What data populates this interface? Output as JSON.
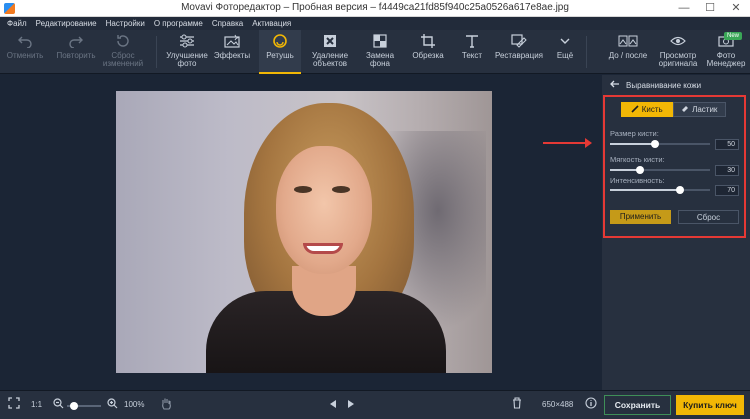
{
  "window": {
    "title": "Movavi Фоторедактор – Пробная версия – f4449ca21fd85f940c25a0526a617e8ae.jpg",
    "minimize": "—",
    "maximize": "☐",
    "close": "✕"
  },
  "menu": [
    "Файл",
    "Редактирование",
    "Настройки",
    "О программе",
    "Справка",
    "Активация"
  ],
  "toolbar": {
    "undo": "Отменить",
    "redo": "Повторить",
    "reset_changes": "Сброс\nизменений",
    "enhance": "Улучшение\nфото",
    "effects": "Эффекты",
    "retouch": "Ретушь",
    "remove_objects": "Удаление\nобъектов",
    "replace_bg": "Замена\nфона",
    "crop": "Обрезка",
    "text": "Текст",
    "restore": "Реставрация",
    "more": "Ещё",
    "before_after": "До / после",
    "view_original": "Просмотр\nоригинала",
    "photo_manager": "Фото\nМенеджер",
    "new_badge": "New"
  },
  "panel": {
    "title": "Выравнивание кожи",
    "brush": "Кисть",
    "eraser": "Ластик",
    "sliders": [
      {
        "label": "Размер кисти:",
        "value": "50",
        "level": 0.45
      },
      {
        "label": "Мягкость кисти:",
        "value": "30",
        "level": 0.3
      },
      {
        "label": "Интенсивность:",
        "value": "70",
        "level": 0.7
      }
    ],
    "apply": "Применить",
    "reset": "Сброс"
  },
  "bottom": {
    "ratio": "1:1",
    "zoom": "100%",
    "image_size": "650×488",
    "save": "Сохранить",
    "buy": "Купить ключ"
  },
  "colors": {
    "accent": "#f2b705",
    "highlight": "#e53935",
    "background": "#1b2535",
    "panel": "#27303f"
  }
}
